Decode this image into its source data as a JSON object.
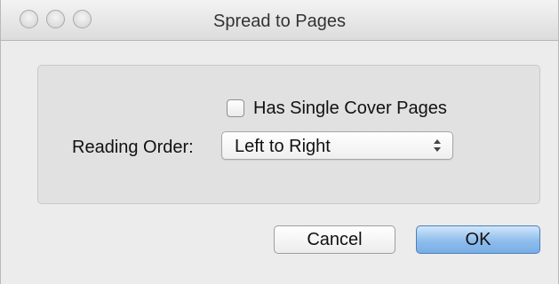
{
  "window": {
    "title": "Spread to Pages"
  },
  "options": {
    "single_cover_label": "Has Single Cover Pages",
    "single_cover_checked": false,
    "reading_order_label": "Reading Order:",
    "reading_order_value": "Left to Right"
  },
  "buttons": {
    "cancel_label": "Cancel",
    "ok_label": "OK"
  },
  "colors": {
    "ok_button": "#8fbdec",
    "window_bg": "#ececec"
  }
}
